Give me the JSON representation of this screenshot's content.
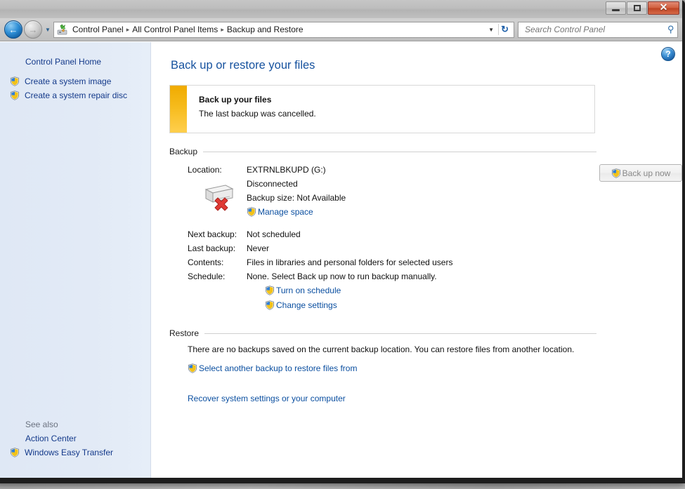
{
  "window": {
    "controls": {
      "minimize": "–",
      "maximize": "□",
      "close": "✕"
    }
  },
  "nav": {
    "back_arrow": "←",
    "forward_arrow": "→",
    "history_dropdown": "▼",
    "breadcrumbs": [
      "Control Panel",
      "All Control Panel Items",
      "Backup and Restore"
    ],
    "separator": "▸",
    "address_dropdown": "▼",
    "refresh": "↻"
  },
  "search": {
    "placeholder": "Search Control Panel",
    "icon": "⚲"
  },
  "sidebar": {
    "home_label": "Control Panel Home",
    "items": [
      {
        "label": "Create a system image"
      },
      {
        "label": "Create a system repair disc"
      }
    ],
    "see_also_label": "See also",
    "see_also_items": [
      {
        "label": "Action Center",
        "shield": false
      },
      {
        "label": "Windows Easy Transfer",
        "shield": true
      }
    ]
  },
  "content": {
    "help_glyph": "?",
    "title": "Back up or restore your files",
    "warning": {
      "title": "Back up your files",
      "message": "The last backup was cancelled."
    },
    "backup": {
      "section_label": "Backup",
      "location_key": "Location:",
      "location_value": "EXTRNLBKUPD (G:)",
      "location_status": "Disconnected",
      "backup_size": "Backup size: Not Available",
      "manage_space_link": "Manage space",
      "backup_now_button": "Back up now",
      "rows": [
        {
          "key": "Next backup:",
          "value": "Not scheduled"
        },
        {
          "key": "Last backup:",
          "value": "Never"
        },
        {
          "key": "Contents:",
          "value": "Files in libraries and personal folders for selected users"
        },
        {
          "key": "Schedule:",
          "value": "None. Select Back up now to run backup manually."
        }
      ],
      "turn_on_schedule_link": "Turn on schedule",
      "change_settings_link": "Change settings"
    },
    "restore": {
      "section_label": "Restore",
      "message": "There are no backups saved on the current backup location. You can restore files from another location.",
      "select_backup_link": "Select another backup to restore files from",
      "recover_link": "Recover system settings or your computer"
    }
  },
  "colors": {
    "accent_blue": "#15519e",
    "link_blue": "#0b4fa0",
    "warning_amber": "#f0ab00",
    "sidebar_bg": "#dfe8f5"
  }
}
